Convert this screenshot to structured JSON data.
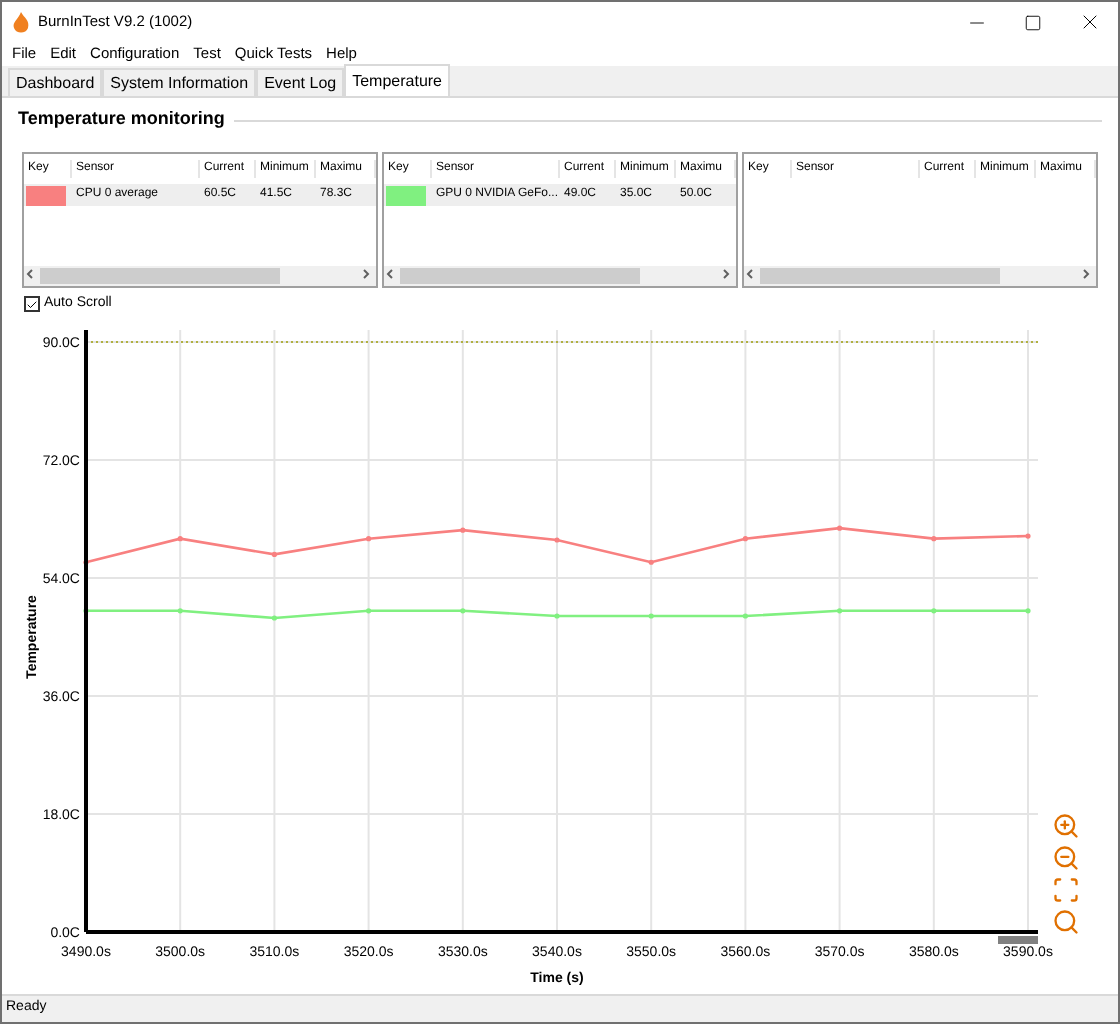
{
  "window": {
    "title": "BurnInTest V9.2 (1002)"
  },
  "menu": [
    "File",
    "Edit",
    "Configuration",
    "Test",
    "Quick Tests",
    "Help"
  ],
  "tabs": [
    {
      "label": "Dashboard",
      "selected": false
    },
    {
      "label": "System Information",
      "selected": false
    },
    {
      "label": "Event Log",
      "selected": false
    },
    {
      "label": "Temperature",
      "selected": true
    }
  ],
  "heading": "Temperature monitoring",
  "sensor_tables": [
    {
      "columns": [
        "Key",
        "Sensor",
        "Current",
        "Minimum",
        "Maximu"
      ],
      "rows": [
        {
          "color": "#f88080",
          "cells": [
            "",
            "CPU 0 average",
            "60.5C",
            "41.5C",
            "78.3C"
          ]
        }
      ]
    },
    {
      "columns": [
        "Key",
        "Sensor",
        "Current",
        "Minimum",
        "Maximu"
      ],
      "rows": [
        {
          "color": "#80f080",
          "cells": [
            "",
            "GPU 0 NVIDIA GeFo...",
            "49.0C",
            "35.0C",
            "50.0C"
          ]
        }
      ]
    },
    {
      "columns": [
        "Key",
        "Sensor",
        "Current",
        "Minimum",
        "Maximu"
      ]
    }
  ],
  "auto_scroll": {
    "label": "Auto Scroll",
    "checked": true
  },
  "chart": {
    "chart_data": {
      "type": "line",
      "xlabel": "Time (s)",
      "ylabel": "Temperature",
      "x": [
        3490,
        3500,
        3510,
        3520,
        3530,
        3540,
        3550,
        3560,
        3570,
        3580,
        3590
      ],
      "series": [
        {
          "color": "#f88080",
          "values": [
            56.4,
            60,
            57.6,
            60,
            61.3,
            59.8,
            56.4,
            60,
            61.6,
            60,
            60.4
          ]
        },
        {
          "color": "#80f080",
          "values": [
            49,
            49,
            47.9,
            49,
            49,
            48.2,
            48.2,
            48.2,
            49,
            49,
            49
          ]
        }
      ],
      "grid": true,
      "xlim": [
        3490,
        3590
      ],
      "ylim": [
        0,
        90
      ],
      "xticks": [
        {
          "value": 3490,
          "label": "3490.0s"
        },
        {
          "value": 3500,
          "label": "3500.0s"
        },
        {
          "value": 3510,
          "label": "3510.0s"
        },
        {
          "value": 3520,
          "label": "3520.0s"
        },
        {
          "value": 3530,
          "label": "3530.0s"
        },
        {
          "value": 3540,
          "label": "3540.0s"
        },
        {
          "value": 3550,
          "label": "3550.0s"
        },
        {
          "value": 3560,
          "label": "3560.0s"
        },
        {
          "value": 3570,
          "label": "3570.0s"
        },
        {
          "value": 3580,
          "label": "3580.0s"
        },
        {
          "value": 3590,
          "label": "3590.0s"
        }
      ],
      "yticks": [
        {
          "value": 0,
          "label": "0.0C"
        },
        {
          "value": 18,
          "label": "18.0C"
        },
        {
          "value": 36,
          "label": "36.0C"
        },
        {
          "value": 54,
          "label": "54.0C"
        },
        {
          "value": 72,
          "label": "72.0C"
        },
        {
          "value": 90,
          "label": "90.0C"
        }
      ]
    }
  },
  "status_bar": "Ready"
}
